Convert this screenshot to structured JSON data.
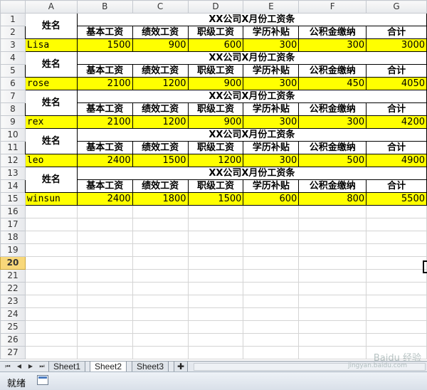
{
  "columns": [
    "",
    "A",
    "B",
    "C",
    "D",
    "E",
    "F",
    "G"
  ],
  "row_numbers": [
    "1",
    "2",
    "3",
    "4",
    "5",
    "6",
    "7",
    "8",
    "9",
    "10",
    "11",
    "12",
    "13",
    "14",
    "15",
    "16",
    "17",
    "18",
    "19",
    "20",
    "21",
    "22",
    "23",
    "24",
    "25",
    "26",
    "27"
  ],
  "selected_row": "20",
  "slip_title": "XX公司X月份工资条",
  "name_header": "姓名",
  "headers": [
    "基本工资",
    "绩效工资",
    "职级工资",
    "学历补贴",
    "公积金缴纳",
    "合计"
  ],
  "employees": [
    {
      "name": "Lisa",
      "values": [
        "1500",
        "900",
        "600",
        "300",
        "300",
        "3000"
      ]
    },
    {
      "name": "rose",
      "values": [
        "2100",
        "1200",
        "900",
        "300",
        "450",
        "4050"
      ]
    },
    {
      "name": "rex",
      "values": [
        "2100",
        "1200",
        "900",
        "300",
        "300",
        "4200"
      ]
    },
    {
      "name": "leo",
      "values": [
        "2400",
        "1500",
        "1200",
        "300",
        "500",
        "4900"
      ]
    },
    {
      "name": "winsun",
      "values": [
        "2400",
        "1800",
        "1500",
        "600",
        "800",
        "5500"
      ]
    }
  ],
  "sheet_tabs": [
    "Sheet1",
    "Sheet2",
    "Sheet3"
  ],
  "active_tab": "Sheet2",
  "nav_buttons": [
    "⏮",
    "◀",
    "▶",
    "⏭"
  ],
  "status_text": "就绪",
  "watermark": "Baidu 经验",
  "watermark_sub": "jingyan.baidu.com",
  "colors": {
    "highlight": "#ffff00",
    "selected_row": "#f8d87a"
  }
}
